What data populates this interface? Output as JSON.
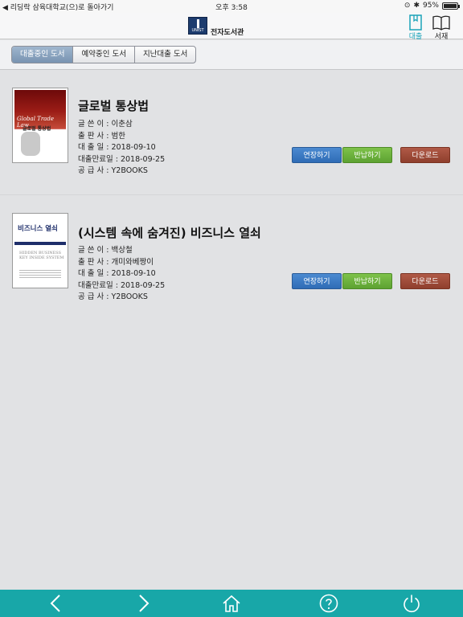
{
  "status_bar": {
    "back_text": "◀ 리딩락 삼육대학교(으)로 돌아가기",
    "time": "오후 3:58",
    "battery": "95%"
  },
  "header": {
    "logo_text": "UNIST",
    "title": "전자도서관",
    "nav_loan": "대출",
    "nav_shelf": "서재",
    "accent_color": "#1aa3b8"
  },
  "tabs": [
    "대출중인 도서",
    "예약중인 도서",
    "지난대출 도서"
  ],
  "books": [
    {
      "title": "글로벌 통상법",
      "cover_text_en": "Global Trade Law",
      "cover_text_ko": "글로벌 통상법",
      "author": "글 쓴 이 : 이춘삼",
      "publisher": "출 판 사 : 범한",
      "loan_date": "대 출 일 : 2018-09-10",
      "due_date": "대출만료일 : 2018-09-25",
      "supplier": "공 급 사 : Y2BOOKS"
    },
    {
      "title": "(시스템 속에 숨겨진) 비즈니스 열쇠",
      "cover_text_ko": "비즈니스 열쇠",
      "cover_text_en": "HIDDEN BUSINESS KEY INSIDE SYSTEM",
      "author": "글 쓴 이 : 백상철",
      "publisher": "출 판 사 : 개미와베짱이",
      "loan_date": "대 출 일 : 2018-09-10",
      "due_date": "대출만료일 : 2018-09-25",
      "supplier": "공 급 사 : Y2BOOKS"
    }
  ],
  "buttons": {
    "extend": "연장하기",
    "return": "반납하기",
    "download": "다운로드"
  },
  "bottom_nav": [
    "back-icon",
    "forward-icon",
    "home-icon",
    "help-icon",
    "power-icon"
  ]
}
